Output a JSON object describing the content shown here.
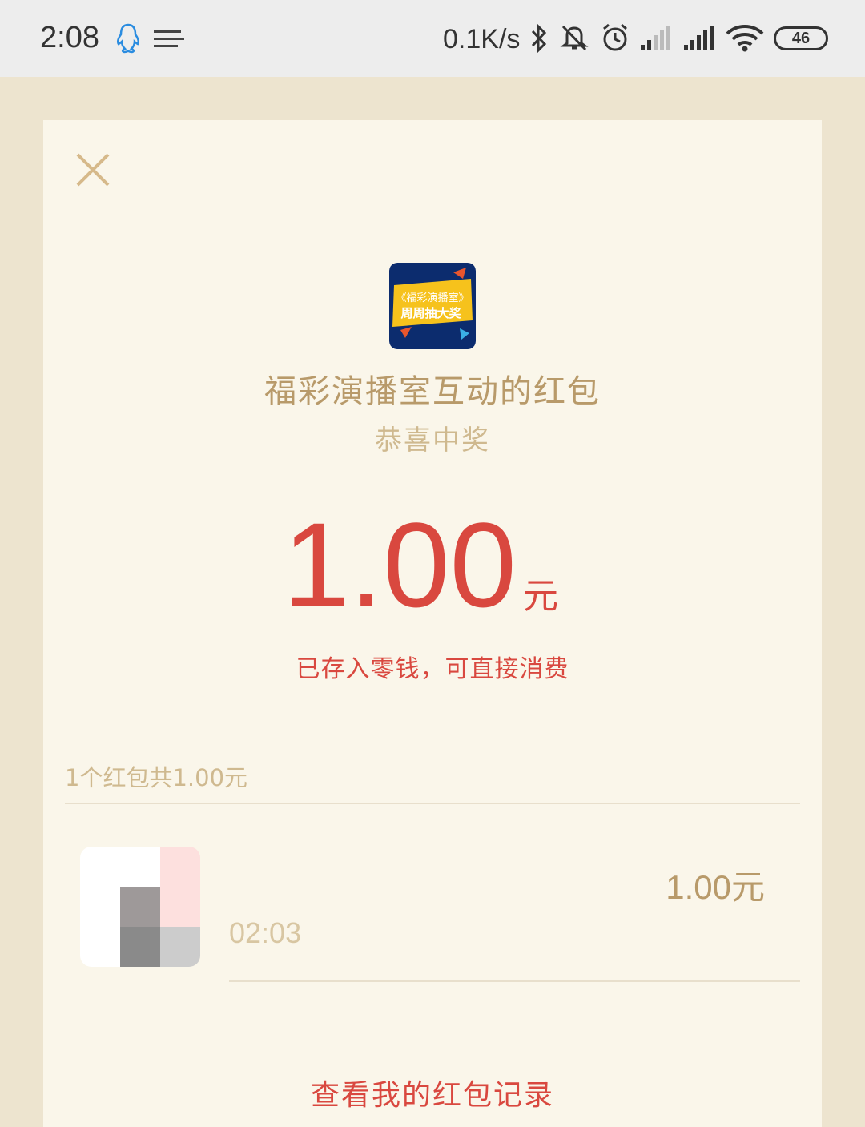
{
  "status_bar": {
    "time": "2:08",
    "net_speed": "0.1K/s",
    "battery": "46",
    "icons": [
      "qq-icon",
      "menu-icon",
      "bluetooth-icon",
      "mute-icon",
      "alarm-icon",
      "signal-icon",
      "signal-icon",
      "wifi-icon",
      "battery-icon"
    ]
  },
  "packet": {
    "logo_line1": "《福彩演播室》",
    "logo_line2": "周周抽大奖",
    "title": "福彩演播室互动的红包",
    "subtitle": "恭喜中奖",
    "amount": "1.00",
    "amount_unit": "元",
    "saved_note": "已存入零钱，可直接消费"
  },
  "summary": "1个红包共1.00元",
  "winners": [
    {
      "time": "02:03",
      "amount": "1.00元"
    }
  ],
  "records_link": "查看我的红包记录",
  "colors": {
    "accent_red": "#d9483f",
    "gold_text": "#b89a6a",
    "card_bg": "#faf6ea",
    "page_bg": "#ede4cf"
  }
}
